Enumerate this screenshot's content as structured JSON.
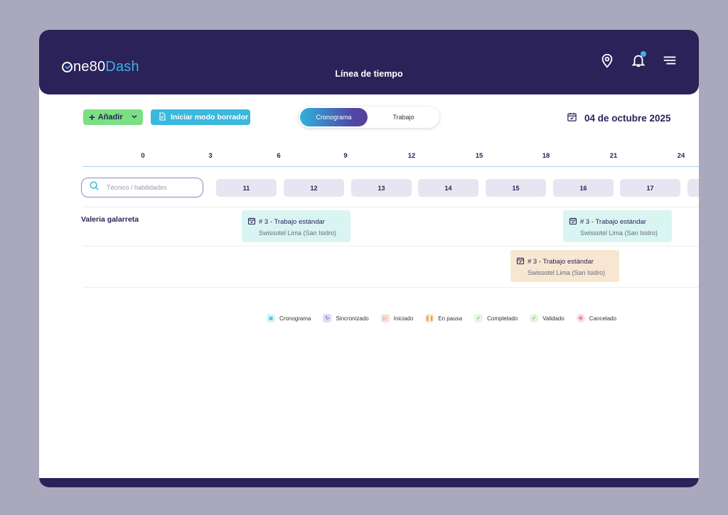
{
  "header": {
    "logo_prefix": "ne80",
    "logo_accent": "Dash",
    "title": "Línea de tiempo",
    "icons": [
      "location-pin-icon",
      "bell-icon",
      "hamburger-menu-icon"
    ]
  },
  "toolbar": {
    "add_label": "Añadir",
    "draft_label": "Iniciar modo borrador",
    "toggle": [
      "Cronograma",
      "Trabajo"
    ],
    "date": "04 de octubre 2025"
  },
  "timeline": {
    "hours": [
      "0",
      "3",
      "6",
      "9",
      "12",
      "15",
      "18",
      "21",
      "24"
    ],
    "days": [
      "11",
      "12",
      "13",
      "14",
      "15",
      "16",
      "17"
    ],
    "search_placeholder": "Técnico / habilidades"
  },
  "rows": [
    {
      "technician": "Valeria galarreta",
      "tasks": [
        {
          "title": "# 3 - Trabajo estándar",
          "location": "Swissotel Lima (San Isidro)",
          "status": "Cronograma"
        },
        {
          "title": "# 3 - Trabajo estándar",
          "location": "Swissotel Lima (San Isidro)",
          "status": "Cronograma"
        },
        {
          "title": "# 3 - Trabajo estándar",
          "location": "Swissotel Lima (San Isidro)",
          "status": "En pausa"
        }
      ]
    }
  ],
  "legend": [
    {
      "label": "Cronograma",
      "color": "#d9f5f2"
    },
    {
      "label": "Sincronizado",
      "color": "#e1dcf5"
    },
    {
      "label": "Iniciado",
      "color": "#fbe0d6"
    },
    {
      "label": "En pausa",
      "color": "#fbe8cf"
    },
    {
      "label": "Completado",
      "color": "#e6f7e3"
    },
    {
      "label": "Validado",
      "color": "#dff5d9"
    },
    {
      "label": "Cancelado",
      "color": "#fbdbe0"
    }
  ],
  "colors": {
    "brand_dark": "#2b2259",
    "accent_blue": "#3fb0e0",
    "add_green": "#7be084"
  }
}
